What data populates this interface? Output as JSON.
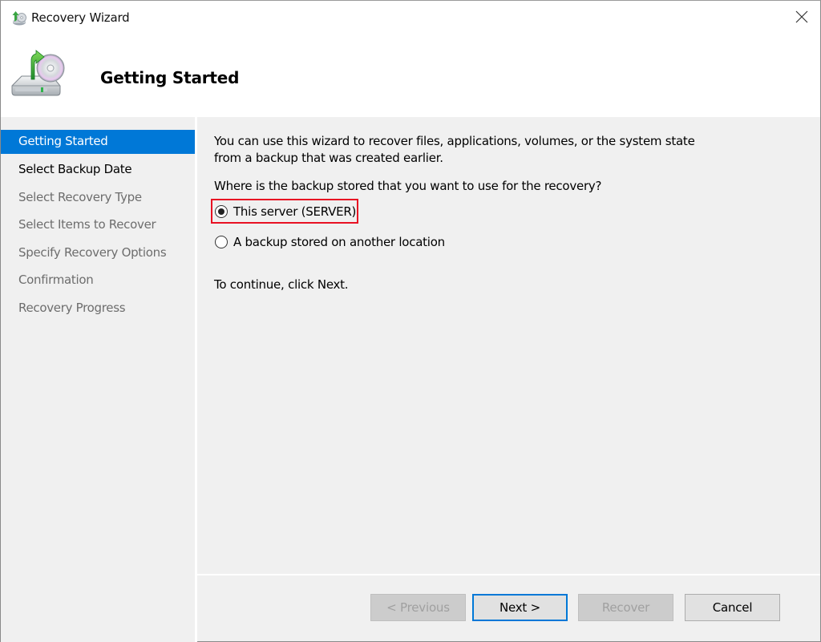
{
  "window": {
    "title": "Recovery Wizard",
    "icon": "recovery-wizard-icon",
    "close_icon": "close-icon"
  },
  "header": {
    "title": "Getting Started",
    "icon": "backup-drive-restore-icon"
  },
  "sidebar": {
    "items": [
      {
        "label": "Getting Started",
        "state": "active"
      },
      {
        "label": "Select Backup Date",
        "state": "next"
      },
      {
        "label": "Select Recovery Type",
        "state": "pending"
      },
      {
        "label": "Select Items to Recover",
        "state": "pending"
      },
      {
        "label": "Specify Recovery Options",
        "state": "pending"
      },
      {
        "label": "Confirmation",
        "state": "pending"
      },
      {
        "label": "Recovery Progress",
        "state": "pending"
      }
    ]
  },
  "main": {
    "intro": "You can use this wizard to recover files, applications, volumes, or the system state from a backup that was created earlier.",
    "question": "Where is the backup stored that you want to use for the recovery?",
    "options": [
      {
        "label": "This server (SERVER)",
        "selected": true,
        "highlighted": true
      },
      {
        "label": "A backup stored on another location",
        "selected": false,
        "highlighted": false
      }
    ],
    "continue_text": "To continue, click Next."
  },
  "footer": {
    "previous_label": "< Previous",
    "next_label": "Next >",
    "recover_label": "Recover",
    "cancel_label": "Cancel"
  },
  "colors": {
    "accent": "#0078d7",
    "highlight_border": "#e81123",
    "panel_bg": "#f0f0f0",
    "disabled_text": "#a0a0a0"
  }
}
